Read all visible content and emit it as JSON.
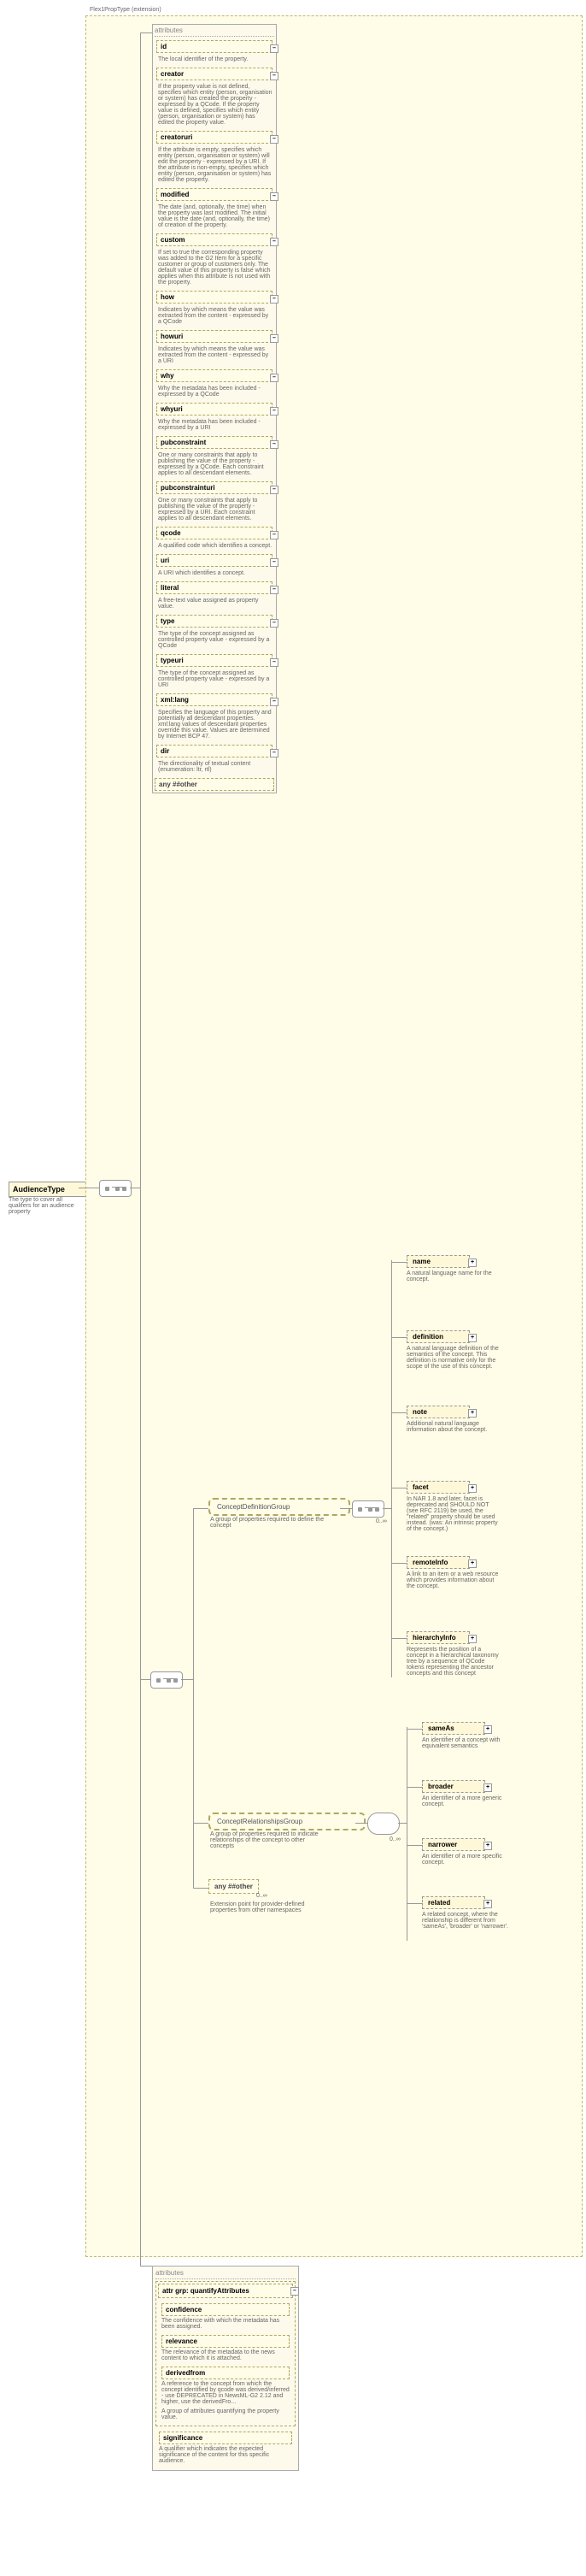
{
  "root": {
    "name": "AudienceType",
    "desc": "The type to cover all qualifers for an audience property"
  },
  "extension_label": "Flex1PropType (extension)",
  "attr_header": "attributes",
  "collapse_minus": "–",
  "expand_plus": "+",
  "attrs": [
    {
      "name": "id",
      "desc": "The local identifier of the property."
    },
    {
      "name": "creator",
      "desc": "If the property value is not defined, specifies which entity (person, organisation or system) has created the property - expressed by a QCode. If the property value is defined, specifies which entity (person, organisation or system) has edited the property value."
    },
    {
      "name": "creatoruri",
      "desc": "If the attribute is empty, specifies which entity (person, organisation or system) will edit the property - expressed by a URI. If the attribute is non-empty, specifies which entity (person, organisation or system) has edited the property."
    },
    {
      "name": "modified",
      "desc": "The date (and, optionally, the time) when the property was last modified. The initial value is the date (and, optionally, the time) of creation of the property."
    },
    {
      "name": "custom",
      "desc": "If set to true the corresponding property was added to the G2 Item for a specific customer or group of customers only. The default value of this property is false which applies when this attribute is not used with the property."
    },
    {
      "name": "how",
      "desc": "Indicates by which means the value was extracted from the content - expressed by a QCode"
    },
    {
      "name": "howuri",
      "desc": "Indicates by which means the value was extracted from the content - expressed by a URI"
    },
    {
      "name": "why",
      "desc": "Why the metadata has been included - expressed by a QCode"
    },
    {
      "name": "whyuri",
      "desc": "Why the metadata has been included - expressed by a URI"
    },
    {
      "name": "pubconstraint",
      "desc": "One or many constraints that apply to publishing the value of the property - expressed by a QCode. Each constraint applies to all descendant elements."
    },
    {
      "name": "pubconstrainturi",
      "desc": "One or many constraints that apply to publishing the value of the property - expressed by a URI. Each constraint applies to all descendant elements."
    },
    {
      "name": "qcode",
      "desc": "A qualified code which identifies a concept."
    },
    {
      "name": "uri",
      "desc": "A URI which identifies a concept."
    },
    {
      "name": "literal",
      "desc": "A free-text value assigned as property value."
    },
    {
      "name": "type",
      "desc": "The type of the concept assigned as controlled property value - expressed by a QCode"
    },
    {
      "name": "typeuri",
      "desc": "The type of the concept assigned as controlled property value - expressed by a URI"
    },
    {
      "name": "xml:lang",
      "desc": "Specifies the language of this property and potentially all descendant properties. xml:lang values of descendant properties override this value. Values are determined by Internet BCP 47."
    },
    {
      "name": "dir",
      "desc": "The directionality of textual content (enumeration: ltr, rtl)"
    }
  ],
  "any_other": "any ##other",
  "groups": {
    "cdg": {
      "name": "ConceptDefinitionGroup",
      "desc": "A group of properties required to define the concept"
    },
    "crg": {
      "name": "ConceptRelationshipsGroup",
      "desc": "A group of properties required to indicate relationships of the concept to other concepts"
    }
  },
  "cdg_elems": [
    {
      "name": "name",
      "desc": "A natural language name for the concept."
    },
    {
      "name": "definition",
      "desc": "A natural language definition of the semantics of the concept. This definition is normative only for the scope of the use of this concept."
    },
    {
      "name": "note",
      "desc": "Additional natural language information about the concept."
    },
    {
      "name": "facet",
      "desc": "In NAR 1.8 and later, facet is deprecated and SHOULD NOT (see RFC 2119) be used, the \"related\" property should be used instead. (was: An intrinsic property of the concept.)"
    },
    {
      "name": "remoteInfo",
      "desc": "A link to an item or a web resource which provides information about the concept."
    },
    {
      "name": "hierarchyInfo",
      "desc": "Represents the position of a concept in a hierarchical taxonomy tree by a sequence of QCode tokens representing the ancestor concepts and this concept"
    }
  ],
  "crg_elems": [
    {
      "name": "sameAs",
      "desc": "An identifier of a concept with equivalent semantics"
    },
    {
      "name": "broader",
      "desc": "An identifier of a more generic concept."
    },
    {
      "name": "narrower",
      "desc": "An identifier of a more specific concept."
    },
    {
      "name": "related",
      "desc": "A related concept, where the relationship is different from 'sameAs', 'broader' or 'narrower'."
    }
  ],
  "ext_any": {
    "name": "any ##other",
    "desc": "Extension point for provider-defined properties from other namespaces",
    "card": "0..∞"
  },
  "card_unbounded": "0..∞",
  "quantify": {
    "title": "attributes",
    "group_label": "attr grp: quantifyAttributes",
    "items": [
      {
        "name": "confidence",
        "desc": "The confidence with which the metadata has been assigned."
      },
      {
        "name": "relevance",
        "desc": "The relevance of the metadata to the news content to which it is attached."
      },
      {
        "name": "derivedfrom",
        "desc": "A reference to the concept from which the concept identified by qcode was derived/inferred - use DEPRECATED in NewsML-G2 2.12 and higher, use the derivedFro..."
      }
    ],
    "group_desc": "A group of attributes quantifying the property value.",
    "significance": {
      "name": "significance",
      "desc": "A qualifier which indicates the expected significance of the content for this specific audience."
    }
  }
}
